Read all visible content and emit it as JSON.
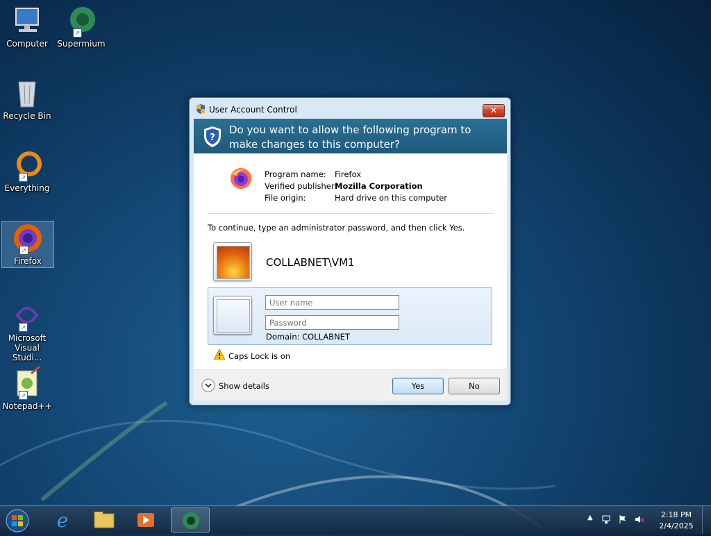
{
  "desktop": {
    "icons": [
      {
        "label": "Computer"
      },
      {
        "label": "Supermium"
      },
      {
        "label": "Recycle Bin"
      },
      {
        "label": "Everything"
      },
      {
        "label": "Firefox"
      },
      {
        "label": "Microsoft Visual Studi..."
      },
      {
        "label": "Notepad++"
      }
    ]
  },
  "dialog": {
    "title": "User Account Control",
    "close_label": "✕",
    "question": "Do you want to allow the following program to make changes to this computer?",
    "program": {
      "name_label": "Program name:",
      "name_value": "Firefox",
      "publisher_label": "Verified publisher:",
      "publisher_value": "Mozilla Corporation",
      "origin_label": "File origin:",
      "origin_value": "Hard drive on this computer"
    },
    "instruction": "To continue, type an administrator password, and then click Yes.",
    "account_name": "COLLABNET\\VM1",
    "username_placeholder": "User name",
    "password_placeholder": "Password",
    "domain_text": "Domain: COLLABNET",
    "caps_lock_text": "Caps Lock is on",
    "show_details_label": "Show details",
    "yes_label": "Yes",
    "no_label": "No"
  },
  "taskbar": {
    "time": "2:18 PM",
    "date": "2/4/2025"
  },
  "colors": {
    "banner": "#1e5a7d",
    "desktop": "#144a78"
  }
}
